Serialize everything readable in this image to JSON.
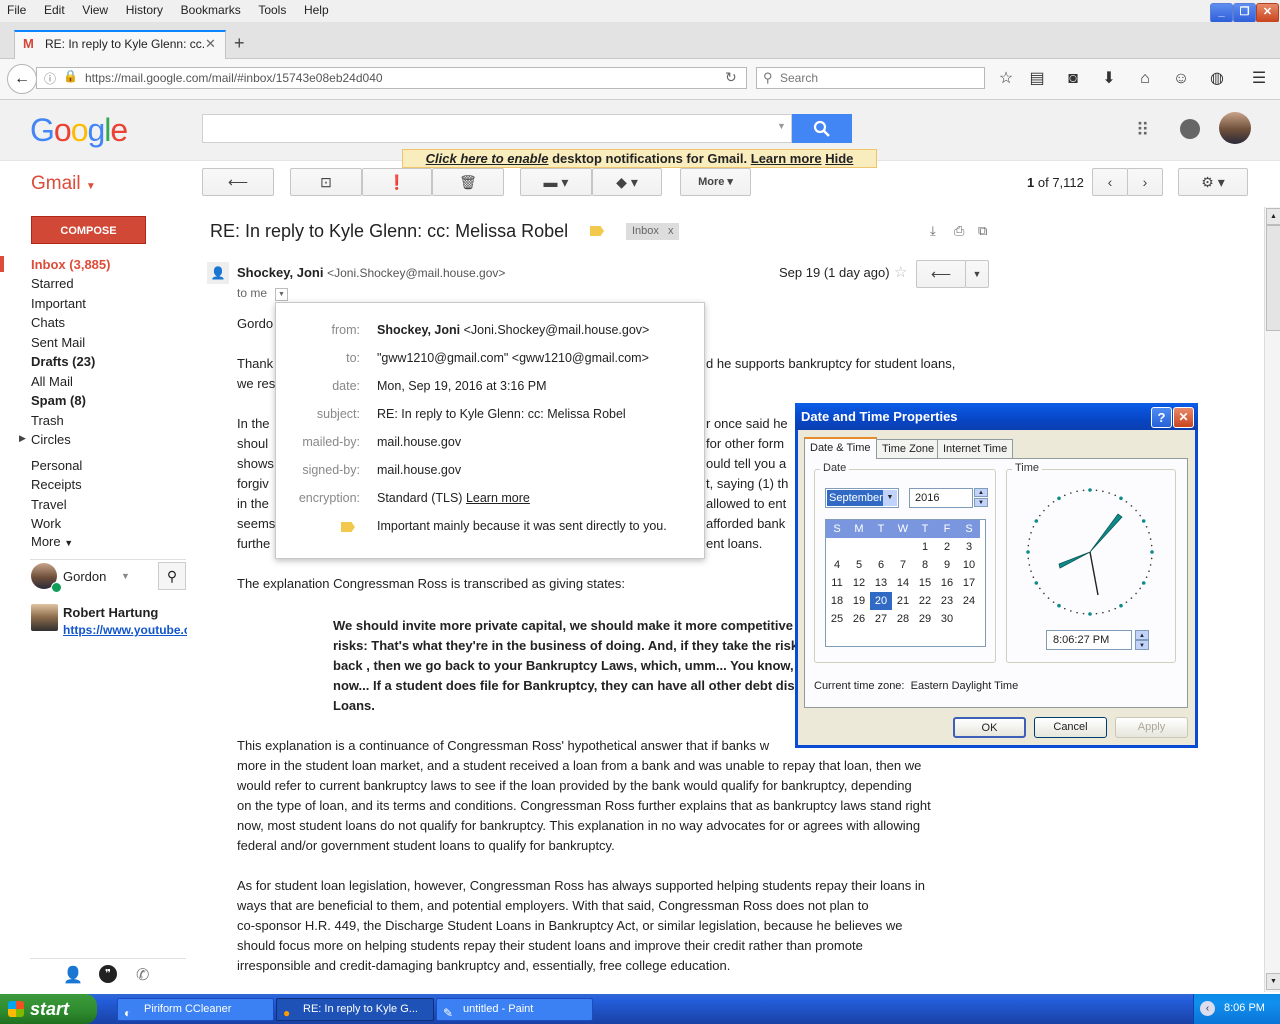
{
  "menubar": {
    "items": [
      "File",
      "Edit",
      "View",
      "History",
      "Bookmarks",
      "Tools",
      "Help"
    ]
  },
  "tab": {
    "title": "RE: In reply to Kyle Glenn: cc...",
    "new_tab": "+"
  },
  "urlbar": {
    "url": "https://mail.google.com/mail/#inbox/15743e08eb24d040"
  },
  "search": {
    "placeholder": "Search"
  },
  "google": {
    "letters": [
      {
        "c": "G",
        "color": "#4285f4"
      },
      {
        "c": "o",
        "color": "#ea4335"
      },
      {
        "c": "o",
        "color": "#fbbc05"
      },
      {
        "c": "g",
        "color": "#4285f4"
      },
      {
        "c": "l",
        "color": "#34a853"
      },
      {
        "c": "e",
        "color": "#ea4335"
      }
    ]
  },
  "notify": {
    "enable": "Click here to enable",
    "text": "desktop notifications for Gmail.",
    "learn": "Learn more",
    "hide": "Hide"
  },
  "gmail": {
    "brand": "Gmail",
    "compose": "COMPOSE",
    "more_label": "More",
    "pager": "1",
    "pager_of": "of 7,112"
  },
  "sidebar": {
    "items": [
      {
        "label": "Inbox (3,885)",
        "bold": true,
        "color": "#dd4b39"
      },
      {
        "label": "Starred"
      },
      {
        "label": "Important"
      },
      {
        "label": "Chats"
      },
      {
        "label": "Sent Mail"
      },
      {
        "label": "Drafts (23)",
        "bold": true
      },
      {
        "label": "All Mail"
      },
      {
        "label": "Spam (8)",
        "bold": true
      },
      {
        "label": "Trash"
      },
      {
        "label": "Circles"
      },
      {
        "label": "Personal"
      },
      {
        "label": "Receipts"
      },
      {
        "label": "Travel"
      },
      {
        "label": "Work"
      },
      {
        "label": "More"
      }
    ],
    "user": "Gordon",
    "contact_name": "Robert Hartung",
    "contact_link": "https://www.youtube.c"
  },
  "email": {
    "subject": "RE: In reply to Kyle Glenn: cc: Melissa Robel",
    "label": "Inbox",
    "label_close": "x",
    "sender_name": "Shockey, Joni",
    "sender_email": "<Joni.Shockey@mail.house.gov>",
    "date": "Sep 19 (1 day ago)",
    "to": "to me",
    "body_frag": [
      "Gordo",
      "Thank",
      "d he supports bankruptcy for student loans,",
      "we res",
      "In the",
      "r once said he",
      "shoul",
      "for other form",
      "shows",
      "ould tell you a",
      "forgiv",
      "t, saying (1) th",
      "in the",
      "allowed to ent",
      "seems",
      "afforded bank",
      "furthe",
      "ent loans."
    ],
    "p_explanation": "The explanation Congressman Ross is transcribed as giving states:",
    "quote": [
      "We should invite more private capital, we should make it more competitive",
      "risks: That's what they're in the business of doing. And, if they take the risk",
      "back , then we go back to your Bankruptcy Laws, which, umm... You know, th",
      "now... If a student does file for Bankruptcy, they can have all other debt disc",
      "Loans."
    ],
    "para2": [
      "This explanation is a continuance of Congressman Ross' hypothetical answer that if banks w",
      "more in the student loan market, and a student received a loan from a bank and was unable to repay that loan, then we",
      "would refer to current bankruptcy laws to see if the loan provided by the bank would qualify for bankruptcy, depending",
      "on the type of loan, and its terms and conditions. Congressman Ross further explains that as bankruptcy laws stand right",
      "now, most student loans do not qualify for bankruptcy. This explanation in no way advocates for or agrees with allowing",
      "federal and/or government student loans to qualify for bankruptcy."
    ],
    "para3": [
      "As for student loan legislation, however, Congressman Ross has always supported helping students repay their loans in",
      "ways that are beneficial to them, and potential employers. With that said, Congressman Ross does not plan to",
      "co-sponsor H.R. 449, the Discharge Student Loans in Bankruptcy Act, or similar legislation, because he believes we",
      "should focus more on helping students repay their student loans and improve their credit rather than promote",
      "irresponsible and credit-damaging bankruptcy and, essentially, free college education."
    ]
  },
  "details": {
    "from_label": "from:",
    "from_name": "Shockey, Joni",
    "from_email": "<Joni.Shockey@mail.house.gov>",
    "to_label": "to:",
    "to": "\"gww1210@gmail.com\" <gww1210@gmail.com>",
    "date_label": "date:",
    "date": "Mon, Sep 19, 2016 at 3:16 PM",
    "subject_label": "subject:",
    "subject": "RE: In reply to Kyle Glenn: cc: Melissa Robel",
    "mailed_label": "mailed-by:",
    "mailed": "mail.house.gov",
    "signed_label": "signed-by:",
    "signed": "mail.house.gov",
    "enc_label": "encryption:",
    "enc": "Standard (TLS)",
    "enc_link": "Learn more",
    "important": "Important mainly because it was sent directly to you."
  },
  "dialog": {
    "title": "Date and Time Properties",
    "help": "?",
    "close": "✕",
    "tabs": [
      "Date & Time",
      "Time Zone",
      "Internet Time"
    ],
    "date_group": "Date",
    "time_group": "Time",
    "month": "September",
    "year": "2016",
    "weekdays": [
      "S",
      "M",
      "T",
      "W",
      "T",
      "F",
      "S"
    ],
    "weeks": [
      [
        "",
        "",
        "",
        "",
        "1",
        "2",
        "3"
      ],
      [
        "4",
        "5",
        "6",
        "7",
        "8",
        "9",
        "10"
      ],
      [
        "11",
        "12",
        "13",
        "14",
        "15",
        "16",
        "17"
      ],
      [
        "18",
        "19",
        "20",
        "21",
        "22",
        "23",
        "24"
      ],
      [
        "25",
        "26",
        "27",
        "28",
        "29",
        "30",
        ""
      ]
    ],
    "selected_day": "20",
    "time": "8:06:27 PM",
    "timezone_label": "Current time zone:",
    "timezone": "Eastern Daylight Time",
    "ok": "OK",
    "cancel": "Cancel",
    "apply": "Apply"
  },
  "taskbar": {
    "start": "start",
    "tasks": [
      "Piriform CCleaner",
      "RE: In reply to Kyle G...",
      "untitled - Paint"
    ],
    "clock": "8:06 PM"
  },
  "colors": {
    "gmail_red": "#dd4b39",
    "google_blue": "#4285f4",
    "xp_blue": "#0a4bd6",
    "xp_green": "#2e8a2e"
  }
}
